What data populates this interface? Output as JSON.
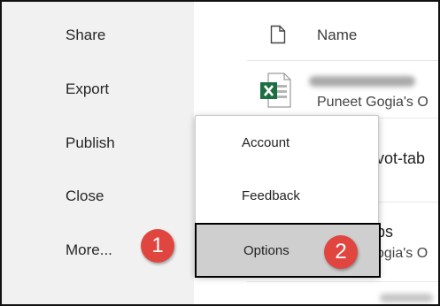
{
  "nav": {
    "items": [
      {
        "label": "Share"
      },
      {
        "label": "Export"
      },
      {
        "label": "Publish"
      },
      {
        "label": "Close"
      },
      {
        "label": "More..."
      }
    ]
  },
  "file_list": {
    "header": {
      "name_label": "Name",
      "icon": "document-icon"
    },
    "rows": [
      {
        "title": "",
        "subtitle": "Puneet Gogia's O",
        "icon": "excel-file-icon"
      },
      {
        "title": "vot-tab",
        "subtitle": ""
      },
      {
        "title": "ps",
        "subtitle": "ogia's O"
      },
      {
        "title": "",
        "subtitle": ""
      }
    ]
  },
  "menu": {
    "items": [
      {
        "label": "Account"
      },
      {
        "label": "Feedback"
      },
      {
        "label": "Options"
      }
    ]
  },
  "callouts": [
    {
      "number": "1"
    },
    {
      "number": "2"
    }
  ],
  "colors": {
    "nav_bg": "#f1f1f1",
    "selected_bg": "#cfcfcf",
    "callout": "#e0463f",
    "excel_green": "#1d6f42"
  }
}
